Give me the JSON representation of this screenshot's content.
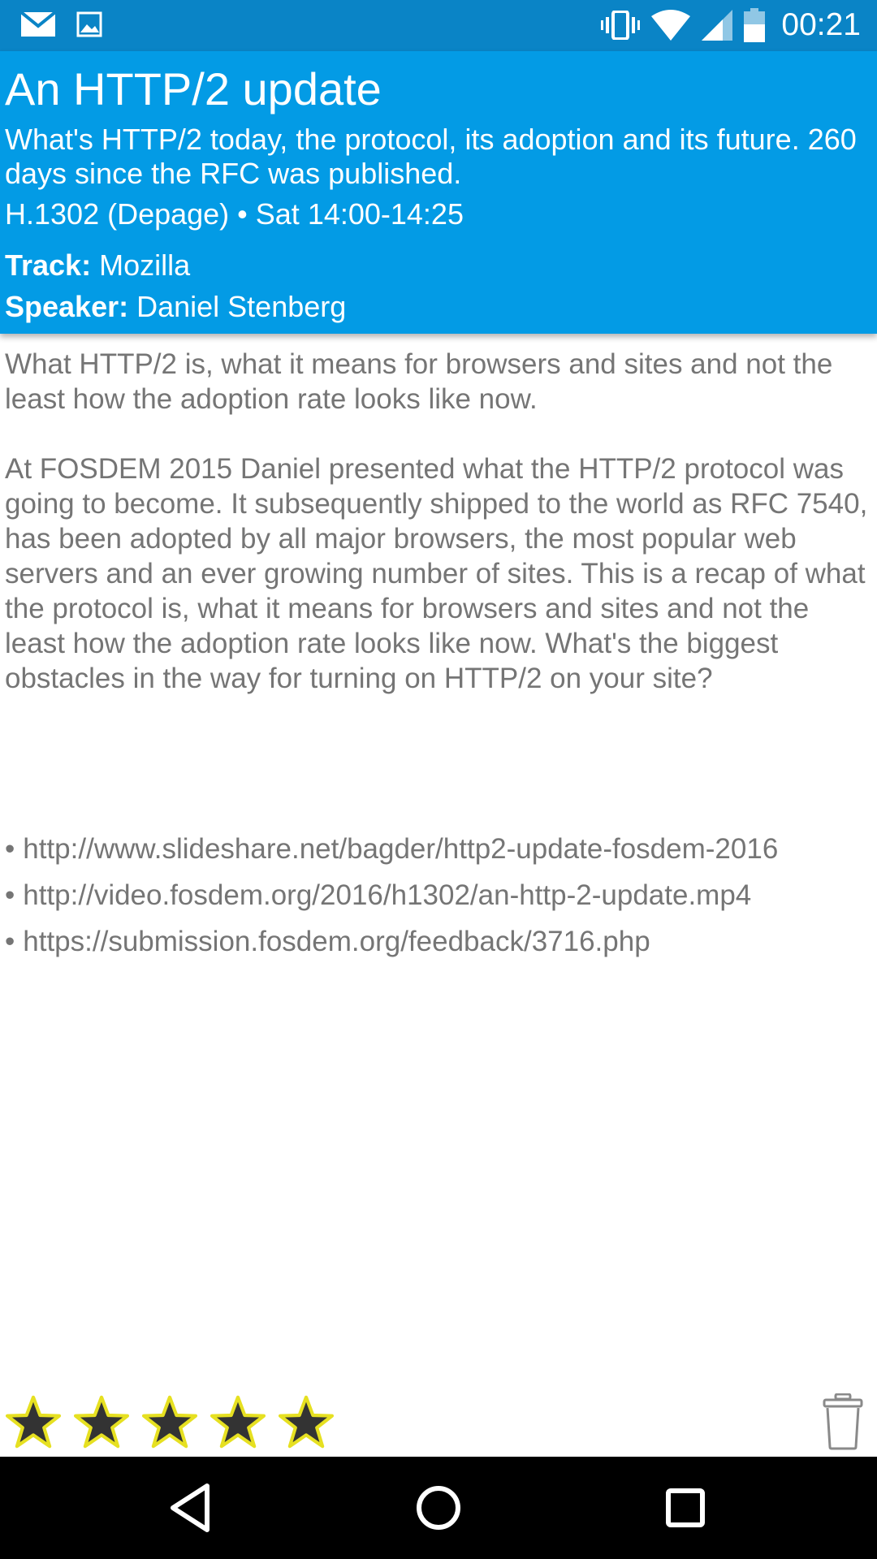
{
  "status_bar": {
    "time": "00:21",
    "left_icons": [
      "email-icon",
      "image-icon"
    ],
    "right_icons": [
      "vibrate-icon",
      "wifi-icon",
      "signal-icon",
      "battery-icon"
    ]
  },
  "header": {
    "title": "An HTTP/2 update",
    "subtitle": "What's HTTP/2 today, the protocol, its adoption and its future. 260 days since the RFC was published.",
    "room_time": "H.1302 (Depage) • Sat 14:00-14:25",
    "track_label": "Track:",
    "track_value": "Mozilla",
    "speaker_label": "Speaker:",
    "speaker_value": "Daniel Stenberg",
    "color": "#039be5"
  },
  "content": {
    "abstract": "What HTTP/2 is, what it means for browsers and sites and not the least how the adoption rate looks like now.",
    "description": "At FOSDEM 2015 Daniel presented what the HTTP/2 protocol was going to become. It subsequently shipped to the world as RFC 7540, has been adopted by all major browsers, the most popular web servers and an ever growing number of sites. This is a recap of what the protocol is, what it means for browsers and sites and not the least how the adoption rate looks like now. What's the biggest obstacles in the way for turning on HTTP/2 on your site?"
  },
  "links": [
    {
      "bullet": "•",
      "url": "http://www.slideshare.net/bagder/http2-update-fosdem-2016"
    },
    {
      "bullet": "•",
      "url": "http://video.fosdem.org/2016/h1302/an-http-2-update.mp4"
    },
    {
      "bullet": "•",
      "url": "https://submission.fosdem.org/feedback/3716.php"
    }
  ],
  "rating": {
    "stars_total": 5,
    "stars_filled": 0,
    "icon": "star-icon"
  },
  "actions": {
    "delete_icon": "trash-icon"
  },
  "nav_bar": {
    "icons": [
      "back-icon",
      "home-icon",
      "recents-icon"
    ]
  }
}
